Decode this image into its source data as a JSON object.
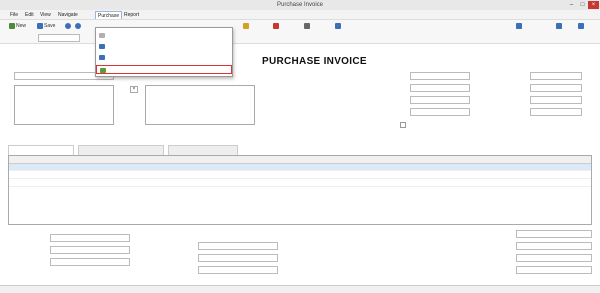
{
  "window": {
    "title": "Purchase Invoice"
  },
  "menubar": {
    "items": [
      "File",
      "Edit",
      "View",
      "Navigate",
      "Purchase",
      "Report"
    ]
  },
  "toolbar": {
    "new_label": "New",
    "save_label": "Save"
  },
  "dropdown": {
    "items": [
      {
        "label": "",
        "shortcut": "",
        "disabled": true
      },
      {
        "label": "",
        "shortcut": "",
        "disabled": false
      },
      {
        "label": "",
        "shortcut": "",
        "disabled": false
      },
      {
        "label": "",
        "shortcut": "",
        "disabled": false,
        "highlighted": true
      }
    ]
  },
  "document": {
    "title": "PURCHASE INVOICE"
  },
  "tabs": [
    {
      "label": ""
    },
    {
      "label": ""
    },
    {
      "label": ""
    }
  ],
  "grid": {
    "columns": [
      "",
      "",
      "",
      "",
      "",
      "",
      "",
      "",
      ""
    ],
    "rows": [
      [
        "",
        "",
        "",
        "",
        "",
        "",
        "",
        "",
        ""
      ],
      [
        "",
        "",
        "",
        "",
        "",
        "",
        "",
        "",
        ""
      ],
      [
        "",
        "",
        "",
        "",
        "",
        "",
        "",
        "",
        ""
      ]
    ]
  },
  "colors": {
    "titlebar_bg": "#e8e8e8",
    "close_button": "#c7372f",
    "selection_row": "#dce9f7",
    "highlight_border": "#dd3333"
  }
}
